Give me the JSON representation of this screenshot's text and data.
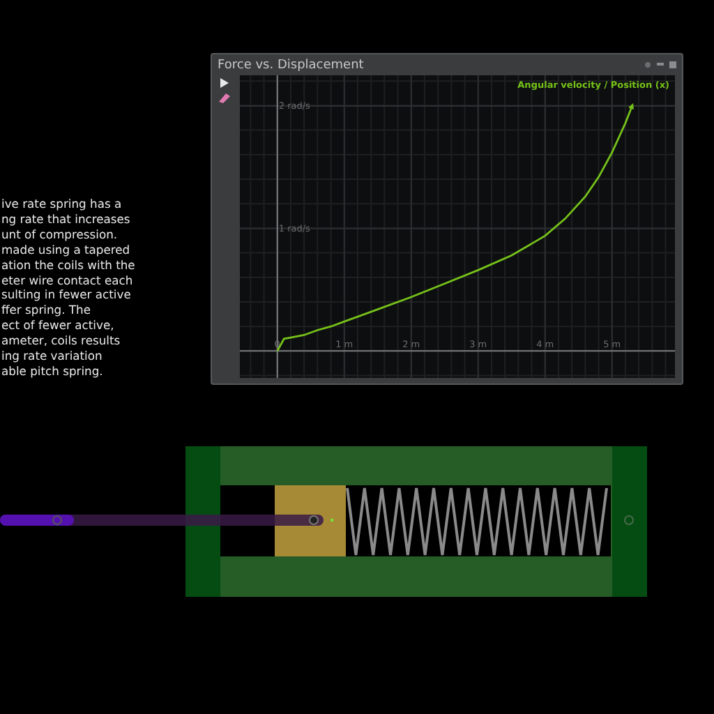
{
  "description": {
    "lines": [
      "ive rate spring has a",
      "ng rate that increases",
      "unt of compression.",
      "made using a tapered",
      "ation the coils with the",
      "eter wire contact each",
      "sulting in fewer active",
      "ffer spring. The",
      "ect of fewer active,",
      "ameter, coils results",
      "ing rate variation",
      "able pitch spring."
    ]
  },
  "graph_window": {
    "title": "Force vs. Displacement",
    "chart_data": {
      "type": "line",
      "grid": true,
      "x": [
        0,
        0.1,
        0.2,
        0.4,
        0.6,
        0.8,
        1,
        1.5,
        2,
        2.5,
        3,
        3.5,
        4,
        4.3,
        4.6,
        4.8,
        5,
        5.2,
        5.3
      ],
      "series": [
        {
          "name": "Angular velocity / Position (x)",
          "color": "#76c21a",
          "values": [
            0,
            0.1,
            0.11,
            0.13,
            0.17,
            0.2,
            0.24,
            0.34,
            0.44,
            0.55,
            0.66,
            0.78,
            0.94,
            1.08,
            1.26,
            1.42,
            1.62,
            1.86,
            2.0
          ]
        }
      ],
      "xlim": [
        -0.56,
        5.94
      ],
      "ylim": [
        -0.22,
        2.25
      ],
      "xticks": [
        {
          "value": 0,
          "label": "0"
        },
        {
          "value": 1,
          "label": "1 m"
        },
        {
          "value": 2,
          "label": "2 m"
        },
        {
          "value": 3,
          "label": "3 m"
        },
        {
          "value": 4,
          "label": "4 m"
        },
        {
          "value": 5,
          "label": "5 m"
        }
      ],
      "yticks": [
        {
          "value": 1,
          "label": "1 rad/s"
        },
        {
          "value": 2,
          "label": "2 rad/s"
        }
      ]
    }
  }
}
